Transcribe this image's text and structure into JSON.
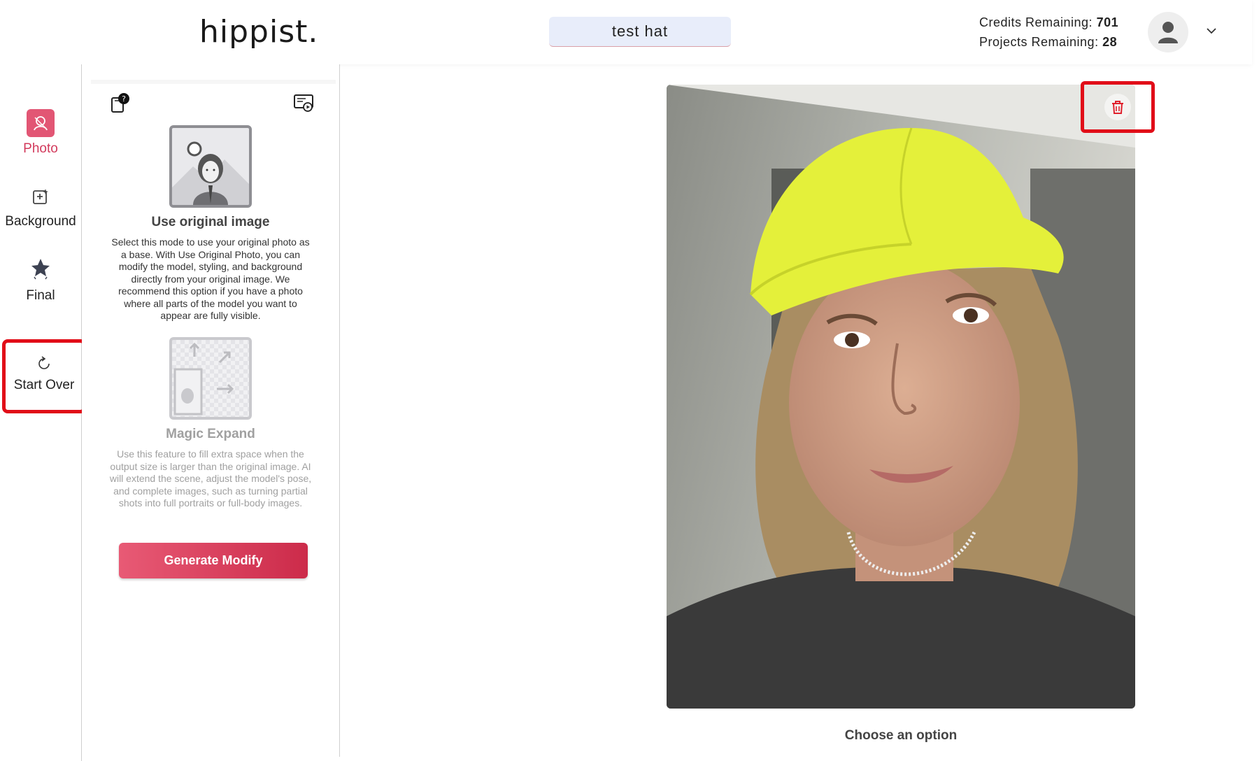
{
  "header": {
    "logo": "hippist.",
    "project_name": "test hat",
    "credits_label": "Credits Remaining:",
    "credits_value": "701",
    "projects_label": "Projects Remaining:",
    "projects_value": "28"
  },
  "sidebar": {
    "items": [
      {
        "label": "Photo",
        "icon": "photo-icon",
        "active": true
      },
      {
        "label": "Background",
        "icon": "background-icon"
      },
      {
        "label": "Final",
        "icon": "final-icon"
      }
    ],
    "start_over": "Start Over"
  },
  "panel": {
    "modes": [
      {
        "title": "Use original image",
        "description": "Select this mode to use your original photo as a base. With Use Original Photo, you can modify the model, styling, and background directly from your original image. We recommend this option if you have a photo where all parts of the model you want to appear are fully visible."
      },
      {
        "title": "Magic Expand",
        "description": "Use this feature to fill extra space when the output size is larger than the original image. AI will extend the scene, adjust the model's pose, and complete images, such as turning partial shots into full portraits or full-body images."
      }
    ],
    "generate_button": "Generate Modify"
  },
  "main": {
    "choose_label": "Choose an option"
  },
  "colors": {
    "accent": "#e25674",
    "highlight": "#e10d18",
    "project_bg": "#e8edfa"
  }
}
